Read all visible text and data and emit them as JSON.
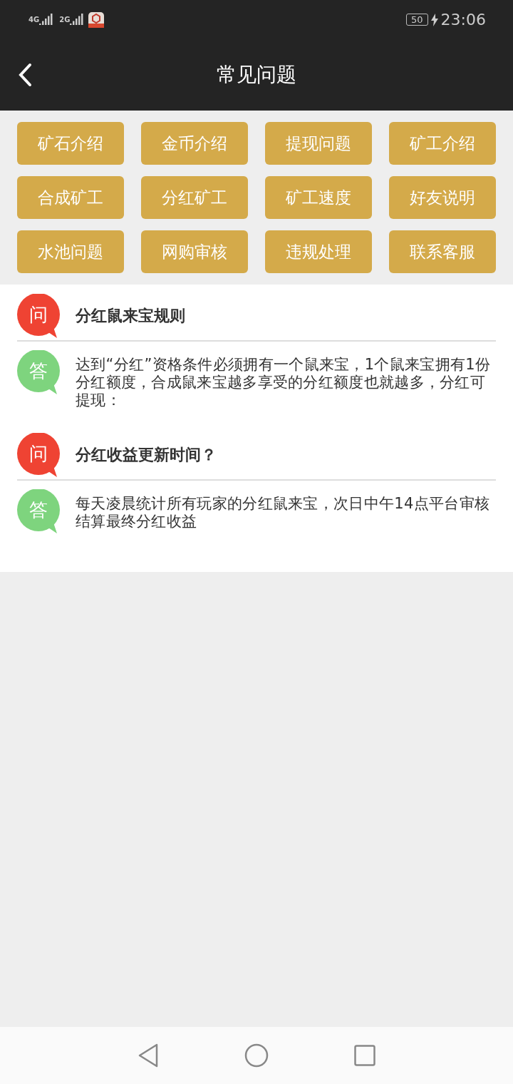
{
  "status_bar": {
    "network_1": "4G",
    "network_2": "2G",
    "battery": "50",
    "charging": true,
    "time": "23:06"
  },
  "header": {
    "title": "常见问题"
  },
  "topics": [
    {
      "label": "矿石介绍"
    },
    {
      "label": "金币介绍"
    },
    {
      "label": "提现问题"
    },
    {
      "label": "矿工介绍"
    },
    {
      "label": "合成矿工"
    },
    {
      "label": "分红矿工"
    },
    {
      "label": "矿工速度"
    },
    {
      "label": "好友说明"
    },
    {
      "label": "水池问题"
    },
    {
      "label": "网购审核"
    },
    {
      "label": "违规处理"
    },
    {
      "label": "联系客服"
    }
  ],
  "faq": [
    {
      "question_badge": "问",
      "question": "分红鼠来宝规则",
      "answer_badge": "答",
      "answer": "达到“分红”资格条件必须拥有一个鼠来宝，1个鼠来宝拥有1份分红额度，合成鼠来宝越多享受的分红额度也就越多，分红可提现："
    },
    {
      "question_badge": "问",
      "question": "分红收益更新时间？",
      "answer_badge": "答",
      "answer": "每天凌晨统计所有玩家的分红鼠来宝，次日中午14点平台审核结算最终分红收益"
    }
  ]
}
